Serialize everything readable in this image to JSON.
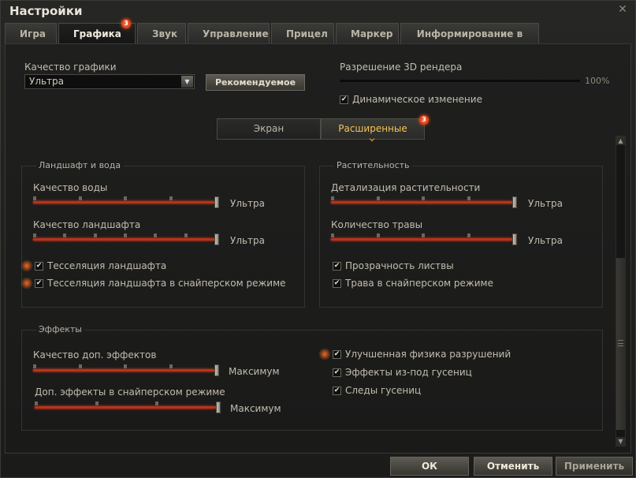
{
  "window": {
    "title": "Настройки",
    "close": "✕"
  },
  "tabs": [
    {
      "label": "Игра"
    },
    {
      "label": "Графика",
      "badge": "3"
    },
    {
      "label": "Звук"
    },
    {
      "label": "Управление"
    },
    {
      "label": "Прицел"
    },
    {
      "label": "Маркер"
    },
    {
      "label": "Информирование в бою"
    }
  ],
  "quality": {
    "label": "Качество графики",
    "value": "Ультра",
    "recommended_button": "Рекомендуемое"
  },
  "render": {
    "label": "Разрешение 3D рендера",
    "value_text": "100%",
    "dynamic_label": "Динамическое изменение",
    "dynamic_checked": true
  },
  "subtabs": {
    "screen": "Экран",
    "advanced": "Расширенные",
    "advanced_badge": "3"
  },
  "landscape": {
    "title": "Ландшафт и вода",
    "water_label": "Качество воды",
    "water_value": "Ультра",
    "water_level": 1.0,
    "terrain_label": "Качество ландшафта",
    "terrain_value": "Ультра",
    "terrain_level": 1.0,
    "tess_label": "Тесселяция ландшафта",
    "tess_sniper_label": "Тесселяция ландшафта в снайперском режиме"
  },
  "vegetation": {
    "title": "Растительность",
    "detail_label": "Детализация растительности",
    "detail_value": "Ультра",
    "detail_level": 1.0,
    "grass_label": "Количество травы",
    "grass_value": "Ультра",
    "grass_level": 1.0,
    "foliage_label": "Прозрачность листвы",
    "grass_sniper_label": "Трава в снайперском режиме"
  },
  "effects": {
    "title": "Эффекты",
    "extra_label": "Качество доп. эффектов",
    "extra_value": "Максимум",
    "extra_level": 1.0,
    "extra_sniper_label": "Доп. эффекты в снайперском режиме",
    "extra_sniper_value": "Максимум",
    "extra_sniper_level": 1.0,
    "physics_label": "Улучшенная физика разрушений",
    "tracks_fx_label": "Эффекты из-под гусениц",
    "tracks_label": "Следы гусениц"
  },
  "footer": {
    "ok": "ОК",
    "cancel": "Отменить",
    "apply": "Применить"
  },
  "colors": {
    "accent": "#c8341a",
    "highlight": "#f3c35a"
  }
}
